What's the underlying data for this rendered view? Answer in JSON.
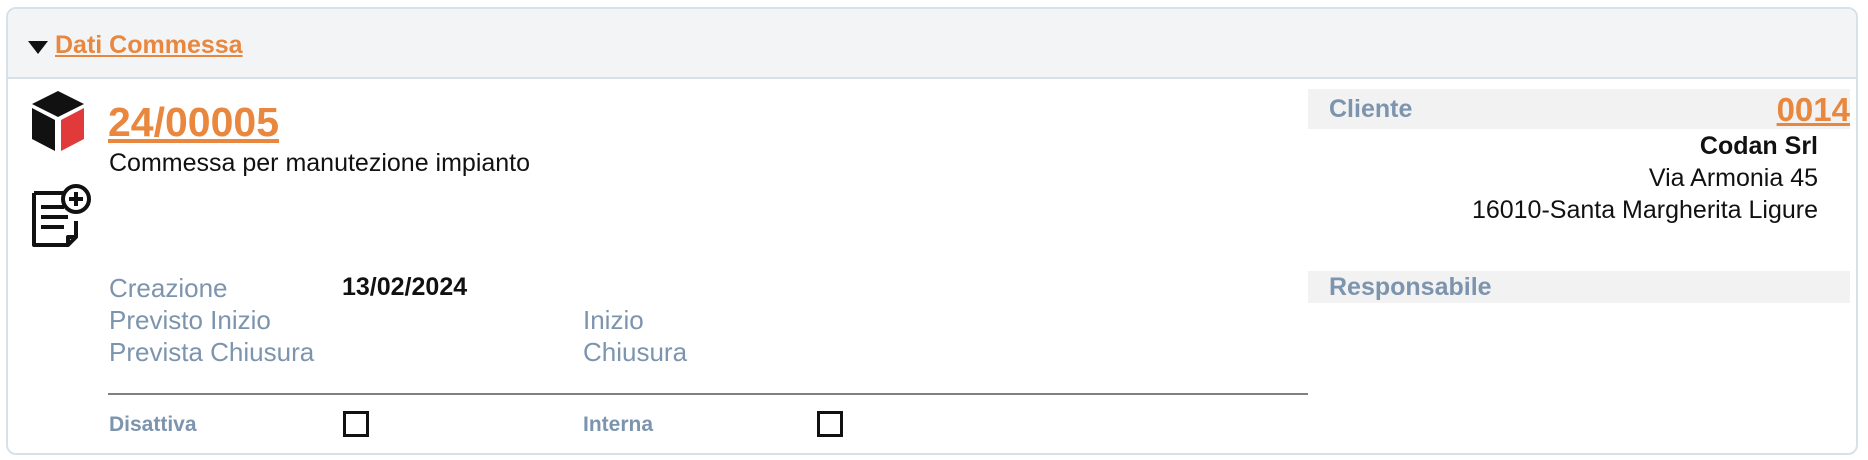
{
  "header": {
    "title": "Dati Commessa"
  },
  "commessa": {
    "code": "24/00005",
    "description": "Commessa per manutezione impianto"
  },
  "dates": {
    "creazione_label": "Creazione",
    "creazione_value": "13/02/2024",
    "previsto_inizio_label": "Previsto Inizio",
    "prevista_chiusura_label": "Prevista Chiusura",
    "inizio_label": "Inizio",
    "chiusura_label": "Chiusura"
  },
  "flags": {
    "disattiva_label": "Disattiva",
    "interna_label": "Interna"
  },
  "cliente": {
    "label": "Cliente",
    "code": "0014",
    "name": "Codan Srl",
    "address": "Via Armonia 45",
    "city": "16010-Santa Margherita Ligure"
  },
  "responsabile": {
    "label": "Responsabile"
  },
  "colors": {
    "accent": "#e8873d",
    "label": "#7c94ad",
    "border": "#d6e2ea",
    "header_bg": "#f2f4f6"
  },
  "icons": {
    "toggle": "triangle-down-icon",
    "product": "cube-icon",
    "add_note": "document-add-icon"
  }
}
